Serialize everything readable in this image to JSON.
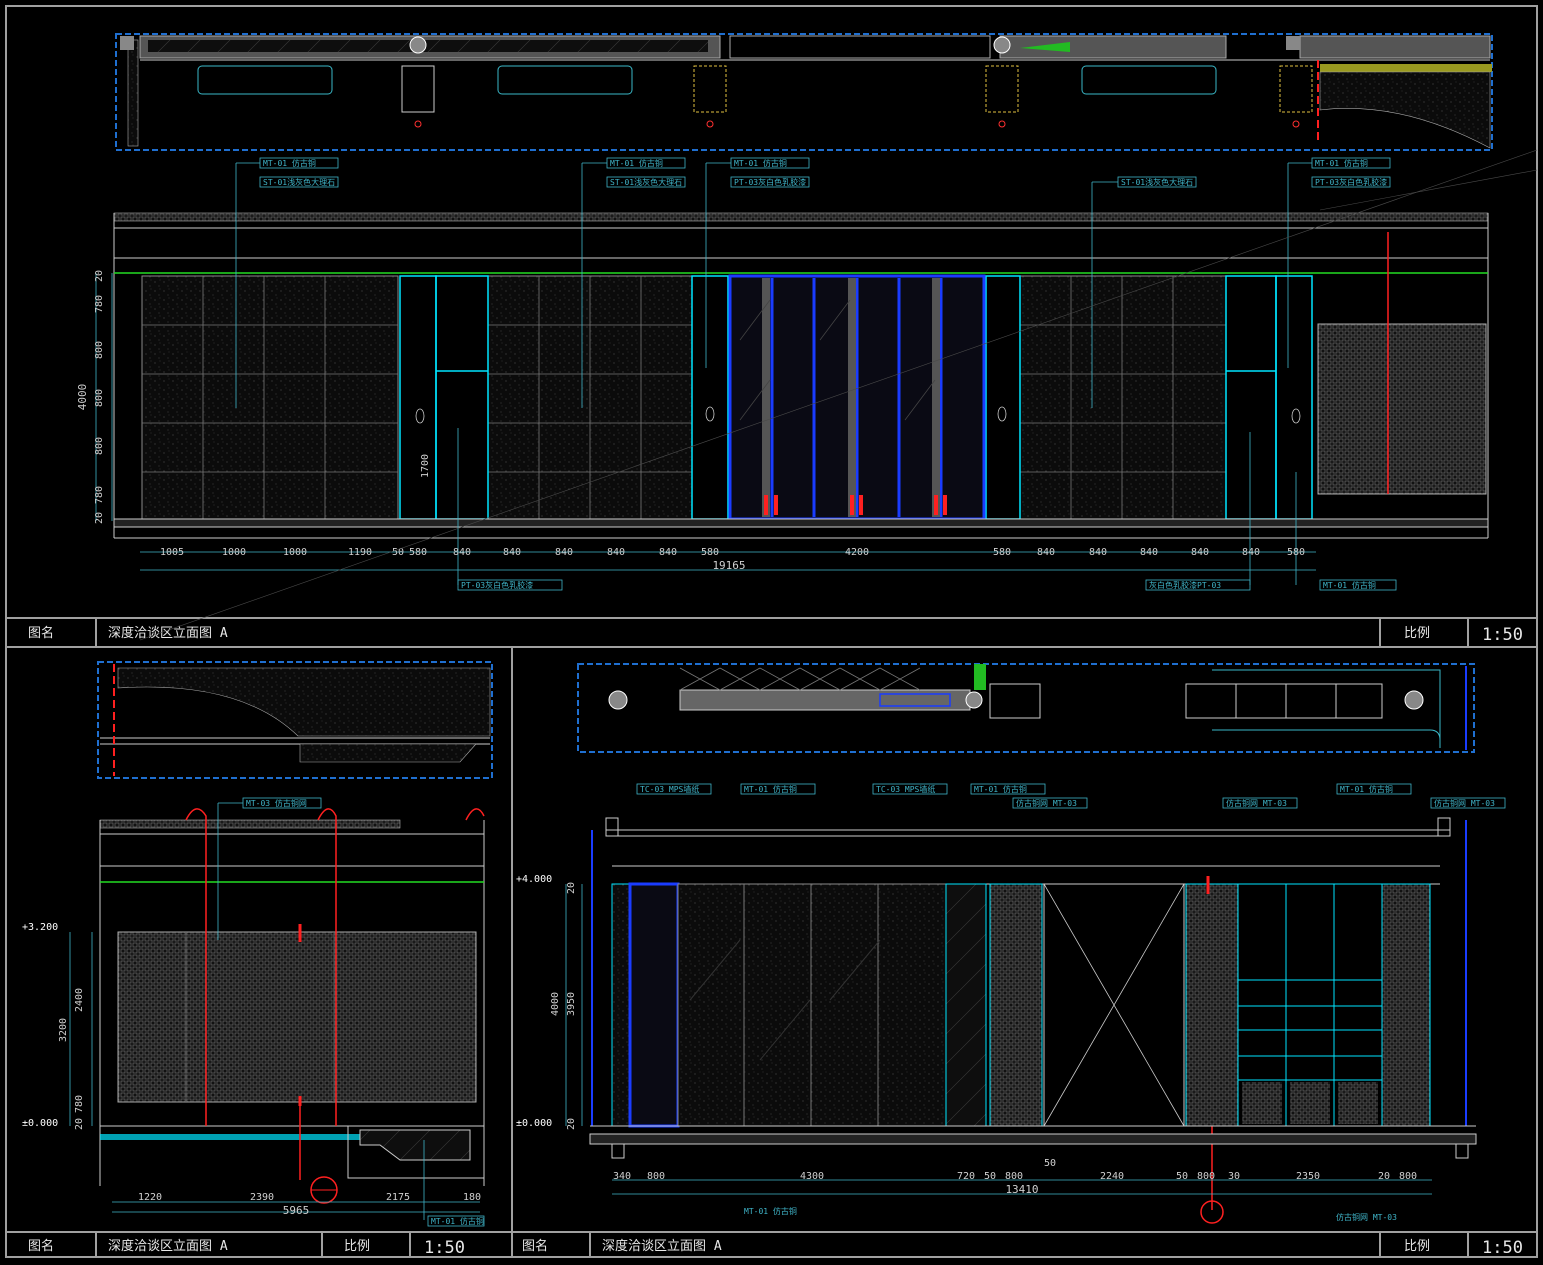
{
  "title_blocks": [
    {
      "label_name": "图名",
      "drawing_name": "深度洽谈区立面图 A",
      "label_scale": "比例",
      "scale": "1:50"
    },
    {
      "label_name": "图名",
      "drawing_name": "深度洽谈区立面图 A",
      "label_scale": "比例",
      "scale": "1:50"
    },
    {
      "label_name": "图名",
      "drawing_name": "深度洽谈区立面图 A",
      "label_scale": "比例",
      "scale": "1:50"
    }
  ],
  "top_elevation": {
    "callouts": [
      "MT-01 仿古铜",
      "ST-01浅灰色大理石",
      "MT-01 仿古铜",
      "ST-01浅灰色大理石",
      "MT-01 仿古铜",
      "PT-03灰白色乳胶漆",
      "ST-01浅灰色大理石",
      "MT-01 仿古铜",
      "PT-03灰白色乳胶漆"
    ],
    "bottom_callouts": [
      "PT-03灰白色乳胶漆",
      "灰白色乳胶漆PT-03",
      "MT-01 仿古铜"
    ],
    "dims_bottom": [
      "1005",
      "1000",
      "1000",
      "1190",
      "50",
      "580",
      "840",
      "840",
      "840",
      "840",
      "840",
      "580",
      "4200",
      "580",
      "840",
      "840",
      "840",
      "840",
      "840",
      "580"
    ],
    "dim_total": "19165",
    "dims_left": [
      "20",
      "780",
      "800",
      "800",
      "800",
      "780",
      "20"
    ],
    "dim_left_total": "4000",
    "dim_door": "1700"
  },
  "bottom_left_elevation": {
    "callouts": [
      "MT-03 仿古铜网",
      "MT-01 仿古铜"
    ],
    "levels": [
      "+3.200",
      "±0.000"
    ],
    "dims_left": [
      "3200",
      "2400",
      "780",
      "20"
    ],
    "dims_bottom": [
      "1220",
      "2390",
      "2175",
      "180"
    ],
    "dim_total": "5965"
  },
  "bottom_right_elevation": {
    "callouts": [
      "TC-03 MPS墙纸",
      "MT-01 仿古铜",
      "TC-03 MPS墙纸",
      "MT-01 仿古铜",
      "仿古铜网 MT-03",
      "仿古铜网 MT-03",
      "MT-01 仿古铜",
      "仿古铜网 MT-03"
    ],
    "bottom_callouts": [
      "MT-01 仿古铜",
      "仿古铜网 MT-03"
    ],
    "levels": [
      "+4.000",
      "±0.000"
    ],
    "dims_left": [
      "4000",
      "3950",
      "20",
      "20"
    ],
    "dims_bottom": [
      "340",
      "800",
      "4300",
      "720",
      "50",
      "800",
      "2240",
      "50",
      "800",
      "30",
      "2350",
      "20",
      "800"
    ],
    "dim_extra": "50",
    "dim_total": "13410"
  },
  "colors": {
    "frame": "#a0a0a0",
    "panel_cyan": "#00e5ff",
    "blue": "#1a3cff",
    "red": "#ff2020",
    "green": "#22dd22",
    "dim": "#3fb4c8",
    "label_box": "#3a6fd0",
    "wall_grey": "#9a9a9a"
  }
}
